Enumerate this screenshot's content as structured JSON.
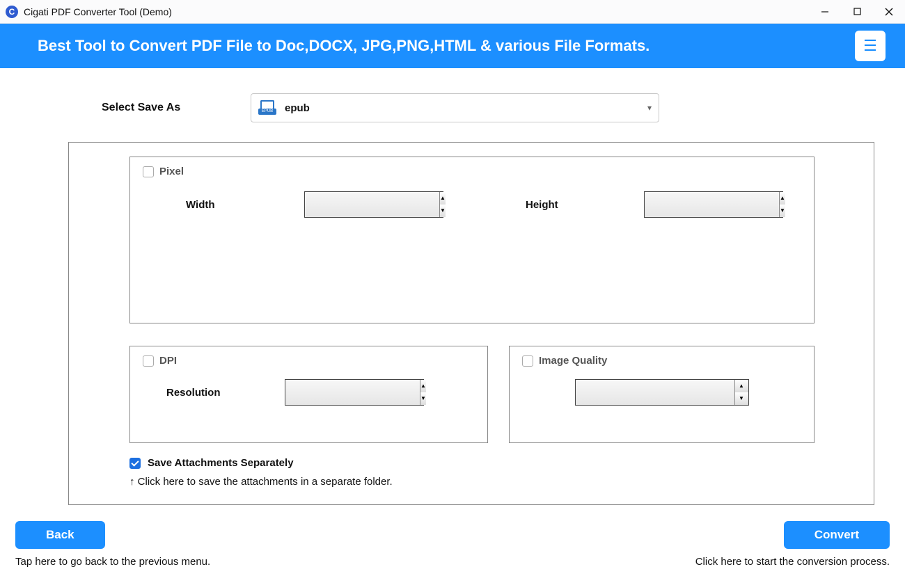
{
  "titlebar": {
    "app_icon_letter": "C",
    "title": "Cigati PDF Converter Tool (Demo)"
  },
  "banner": {
    "text": "Best Tool to Convert PDF File to Doc,DOCX, JPG,PNG,HTML & various File Formats.",
    "menu_glyph": "☰"
  },
  "save_as": {
    "label": "Select Save As",
    "value": "epub",
    "icon_text": "EPUB"
  },
  "pixel": {
    "checkbox_label": "Pixel",
    "checked": false,
    "width_label": "Width",
    "width_value": "",
    "height_label": "Height",
    "height_value": ""
  },
  "dpi": {
    "checkbox_label": "DPI",
    "checked": false,
    "resolution_label": "Resolution",
    "resolution_value": ""
  },
  "image_quality": {
    "checkbox_label": "Image Quality",
    "checked": false,
    "value": ""
  },
  "attachments": {
    "checked": true,
    "label": "Save Attachments Separately",
    "hint": "↑ Click here to save the attachments in a separate folder."
  },
  "footer": {
    "back_label": "Back",
    "convert_label": "Convert",
    "back_hint": "Tap here to go back to the previous menu.",
    "convert_hint": "Click here to start the conversion process."
  }
}
